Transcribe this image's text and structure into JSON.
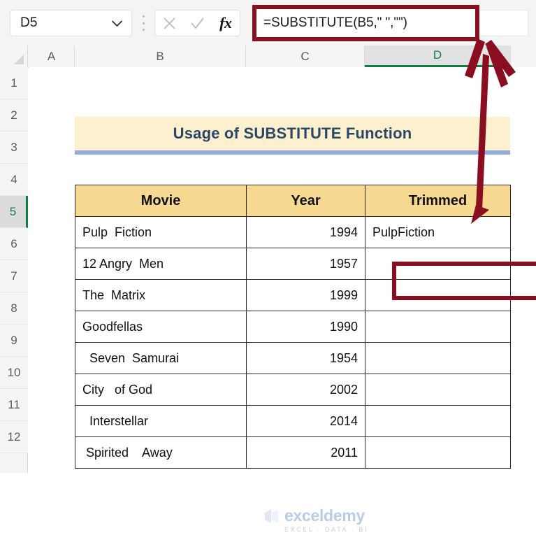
{
  "formula_bar": {
    "name_box_value": "D5",
    "name_box_icon": "chevron-down-icon",
    "cancel_icon": "cancel-x-icon",
    "confirm_icon": "confirm-check-icon",
    "function_icon": "fx-insert-function-icon",
    "formula_value": "=SUBSTITUTE(B5,\" \",\"\")",
    "more_options_icon": "kebab-menu-icon"
  },
  "grid": {
    "column_headers": [
      "A",
      "B",
      "C",
      "D"
    ],
    "selected_column": "D",
    "row_headers": [
      "1",
      "2",
      "3",
      "4",
      "5",
      "6",
      "7",
      "8",
      "9",
      "10",
      "11",
      "12"
    ],
    "selected_row": "5",
    "selected_cell": "D5"
  },
  "banner": {
    "title": "Usage of SUBSTITUTE Function",
    "fill_color": "#FDF0CF",
    "text_color": "#2A4865",
    "underline_color": "#93ABDA"
  },
  "table": {
    "headers": [
      "Movie",
      "Year",
      "Trimmed"
    ],
    "header_fill": "#F8D992",
    "rows": [
      {
        "movie": "Pulp  Fiction",
        "year": "1994",
        "trimmed": "PulpFiction"
      },
      {
        "movie": "12 Angry  Men",
        "year": "1957",
        "trimmed": ""
      },
      {
        "movie": "The  Matrix",
        "year": "1999",
        "trimmed": ""
      },
      {
        "movie": "Goodfellas",
        "year": "1990",
        "trimmed": ""
      },
      {
        "movie": "  Seven  Samurai",
        "year": "1954",
        "trimmed": ""
      },
      {
        "movie": "City   of God",
        "year": "2002",
        "trimmed": ""
      },
      {
        "movie": "  Interstellar",
        "year": "2014",
        "trimmed": ""
      },
      {
        "movie": " Spirited    Away",
        "year": "2011",
        "trimmed": ""
      }
    ]
  },
  "annotation": {
    "highlight_color": "#8B0E20",
    "arrow_name": "red-arrow-pointing-to-formula-bar"
  },
  "watermark": {
    "name": "exceldemy",
    "tagline": "EXCEL · DATA · BI",
    "name_color": "#B9CBE8"
  }
}
